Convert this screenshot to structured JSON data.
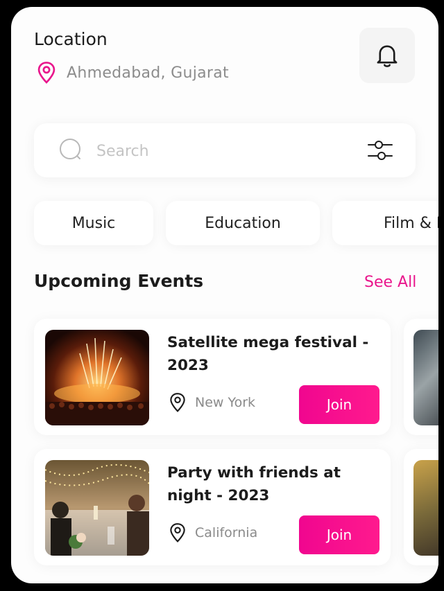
{
  "header": {
    "location_label": "Location",
    "location_value": "Ahmedabad, Gujarat",
    "location_icon": "map-pin-icon",
    "notification_icon": "bell-icon"
  },
  "search": {
    "placeholder": "Search",
    "value": "",
    "search_icon": "search-icon",
    "filter_icon": "filter-sliders-icon"
  },
  "categories": [
    {
      "label": "Music"
    },
    {
      "label": "Education"
    },
    {
      "label": "Film & M"
    }
  ],
  "upcoming": {
    "title": "Upcoming Events",
    "see_all": "See All",
    "events": [
      {
        "title": "Satellite mega festival - 2023",
        "location": "New York",
        "join_label": "Join"
      },
      {
        "title": "Party with friends at night - 2023",
        "location": "California",
        "join_label": "Join"
      }
    ]
  },
  "colors": {
    "accent": "#e9168c",
    "join_button": "#f20a8e",
    "text_primary": "#1c1c1c",
    "text_secondary": "#8c8c8c"
  }
}
